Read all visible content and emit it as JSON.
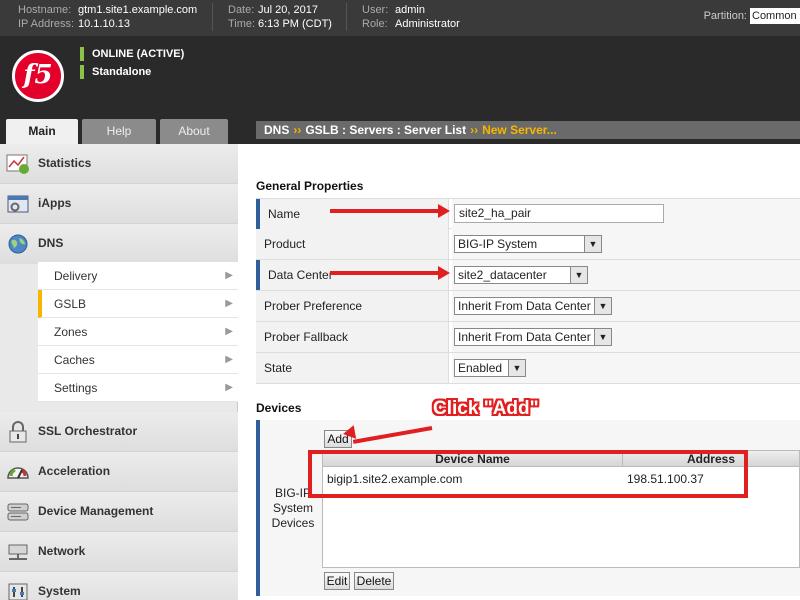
{
  "topbar": {
    "hostname_label": "Hostname:",
    "hostname": "gtm1.site1.example.com",
    "ip_label": "IP Address:",
    "ip": "10.1.10.13",
    "date_label": "Date:",
    "date": "Jul 20, 2017",
    "time_label": "Time:",
    "time": "6:13 PM (CDT)",
    "user_label": "User:",
    "user": "admin",
    "role_label": "Role:",
    "role": "Administrator",
    "partition_label": "Partition:",
    "partition_value": "Common"
  },
  "header": {
    "logo_text": "f5",
    "status_online": "ONLINE (ACTIVE)",
    "status_mode": "Standalone"
  },
  "tabs": [
    {
      "label": "Main",
      "active": true
    },
    {
      "label": "Help",
      "active": false
    },
    {
      "label": "About",
      "active": false
    }
  ],
  "breadcrumb": {
    "parts": [
      "DNS",
      "GSLB : Servers : Server List"
    ],
    "separator": "››",
    "current": "New Server..."
  },
  "sidebar": {
    "sections": [
      {
        "label": "Statistics",
        "icon": "chart-icon"
      },
      {
        "label": "iApps",
        "icon": "iapps-icon"
      },
      {
        "label": "DNS",
        "icon": "globe-icon"
      },
      {
        "label": "SSL Orchestrator",
        "icon": "lock-icon"
      },
      {
        "label": "Acceleration",
        "icon": "gauge-icon"
      },
      {
        "label": "Device Management",
        "icon": "server-icon"
      },
      {
        "label": "Network",
        "icon": "network-icon"
      },
      {
        "label": "System",
        "icon": "system-icon"
      }
    ],
    "dns_items": [
      {
        "label": "Delivery",
        "selected": false
      },
      {
        "label": "GSLB",
        "selected": true
      },
      {
        "label": "Zones",
        "selected": false
      },
      {
        "label": "Caches",
        "selected": false
      },
      {
        "label": "Settings",
        "selected": false
      }
    ]
  },
  "general": {
    "title": "General Properties",
    "name_label": "Name",
    "name_value": "site2_ha_pair",
    "product_label": "Product",
    "product_value": "BIG-IP System",
    "datacenter_label": "Data Center",
    "datacenter_value": "site2_datacenter",
    "prober_pref_label": "Prober Preference",
    "prober_pref_value": "Inherit From Data Center",
    "prober_fallback_label": "Prober Fallback",
    "prober_fallback_value": "Inherit From Data Center",
    "state_label": "State",
    "state_value": "Enabled"
  },
  "devices": {
    "title": "Devices",
    "row_label": "BIG-IP System Devices",
    "add_button": "Add",
    "edit_button": "Edit",
    "delete_button": "Delete",
    "columns": [
      "Device Name",
      "Address"
    ],
    "rows": [
      {
        "device_name": "bigip1.site2.example.com",
        "address": "198.51.100.37"
      }
    ]
  },
  "annotation": {
    "callout": "Click \"Add\"",
    "accent_color": "#e02020"
  },
  "colors": {
    "brand": "#e4002b",
    "status_green": "#8bc34a",
    "breadcrumb_accent": "#f7b500",
    "required_bar": "#2f5f9a"
  }
}
